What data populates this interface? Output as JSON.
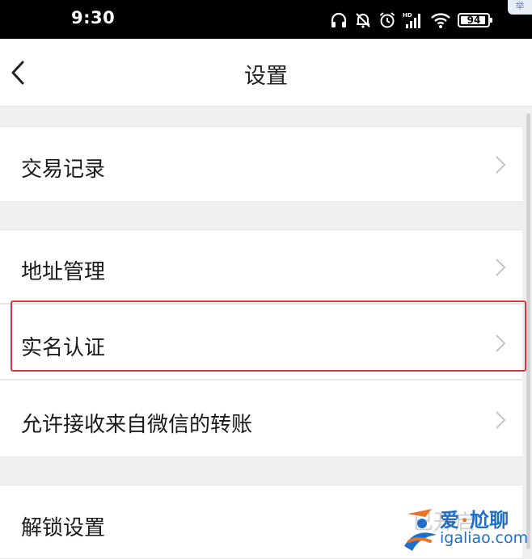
{
  "status_bar": {
    "time": "9:30",
    "network_label": "HD",
    "battery_level": "94",
    "icons": [
      "headphones-icon",
      "mute-bell-icon",
      "alarm-icon",
      "signal-icon",
      "wifi-icon",
      "battery-icon"
    ]
  },
  "corner_tab": {
    "label": "举"
  },
  "header": {
    "title": "设置",
    "back_icon": "chevron-left-icon"
  },
  "settings": {
    "items": [
      {
        "label": "交易记录"
      },
      {
        "label": "地址管理"
      },
      {
        "label": "实名认证"
      },
      {
        "label": "允许接收来自微信的转账"
      },
      {
        "label": "解锁设置"
      }
    ]
  },
  "watermark": {
    "title_part1": "爱",
    "title_dot": "·",
    "title_part2": "尬聊",
    "url": "igaliao.com",
    "ghost_text": "已开启"
  },
  "colors": {
    "status_bar_bg": "#000000",
    "page_bg": "#f0f0f0",
    "row_bg": "#ffffff",
    "highlight_border": "#d9363e",
    "watermark_blue": "#1f6fc9",
    "watermark_orange": "#e8732a"
  }
}
